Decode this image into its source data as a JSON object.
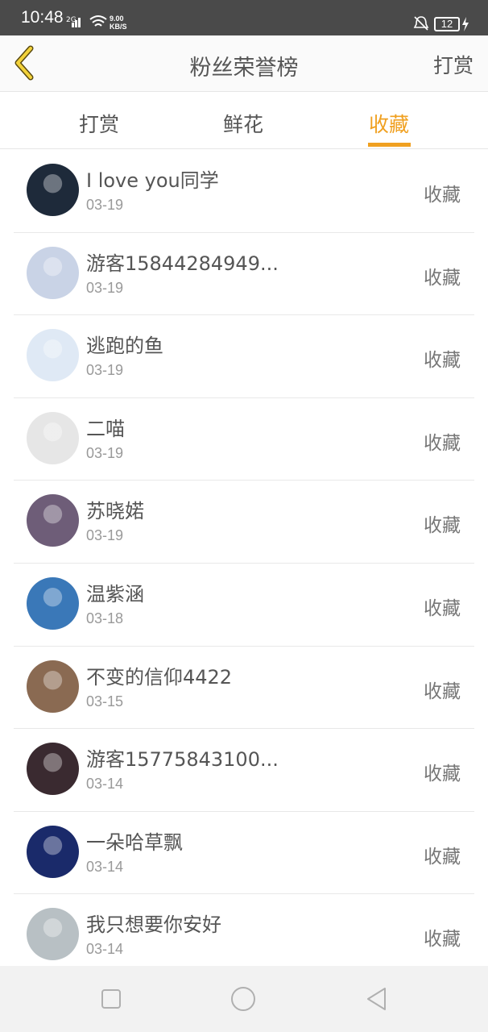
{
  "status": {
    "time": "10:48",
    "net": "2G",
    "speed_value": "9.00",
    "speed_unit": "KB/S",
    "battery": "12"
  },
  "header": {
    "title": "粉丝荣誉榜",
    "right_action": "打赏"
  },
  "tabs": [
    {
      "label": "打赏",
      "active": false
    },
    {
      "label": "鲜花",
      "active": false
    },
    {
      "label": "收藏",
      "active": true
    }
  ],
  "fans": [
    {
      "name": "I love you同学",
      "date": "03-19",
      "action": "收藏",
      "avatar_color": "#1e2a3a"
    },
    {
      "name": "游客15844284949...",
      "date": "03-19",
      "action": "收藏",
      "avatar_color": "#c9d3e6"
    },
    {
      "name": "逃跑的鱼",
      "date": "03-19",
      "action": "收藏",
      "avatar_color": "#dfe9f5"
    },
    {
      "name": "二喵",
      "date": "03-19",
      "action": "收藏",
      "avatar_color": "#e6e6e6"
    },
    {
      "name": "苏晓婼",
      "date": "03-19",
      "action": "收藏",
      "avatar_color": "#6e5d78"
    },
    {
      "name": "温紫涵",
      "date": "03-18",
      "action": "收藏",
      "avatar_color": "#3a78b8"
    },
    {
      "name": "不变的信仰4422",
      "date": "03-15",
      "action": "收藏",
      "avatar_color": "#8a6a52"
    },
    {
      "name": "游客15775843100...",
      "date": "03-14",
      "action": "收藏",
      "avatar_color": "#3a2a30"
    },
    {
      "name": "一朵哈草飘",
      "date": "03-14",
      "action": "收藏",
      "avatar_color": "#1a2a6a"
    },
    {
      "name": "我只想要你安好",
      "date": "03-14",
      "action": "收藏",
      "avatar_color": "#b8c0c4"
    }
  ],
  "colors": {
    "accent": "#f0a020",
    "status_bar": "#4a4a4a"
  },
  "icons": {
    "back": "chevron-left-icon",
    "nav_recent": "square-icon",
    "nav_home": "circle-icon",
    "nav_back": "triangle-left-icon"
  }
}
